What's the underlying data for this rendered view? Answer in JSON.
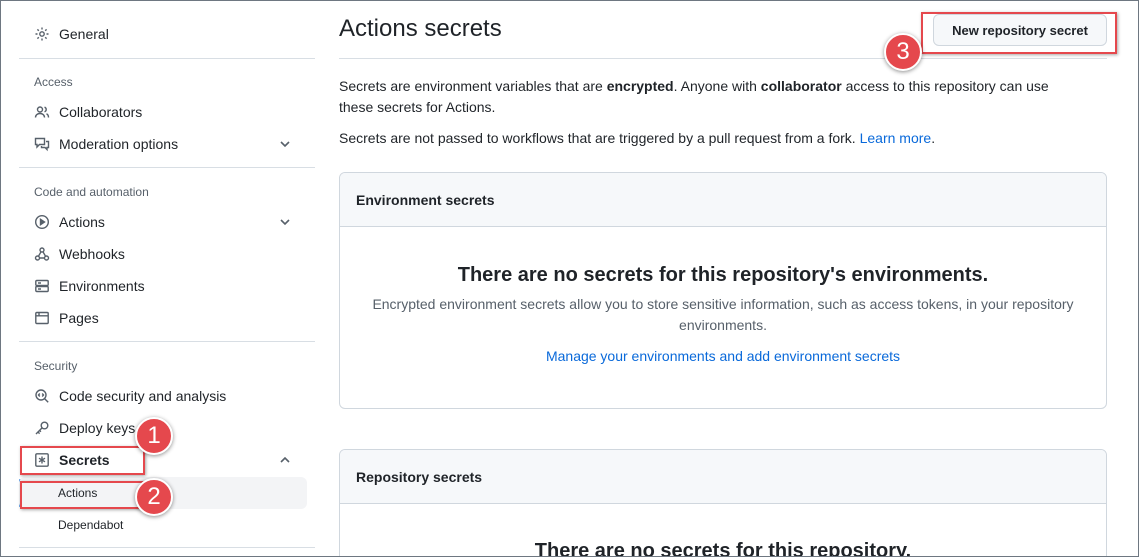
{
  "sidebar": {
    "general": "General",
    "access_label": "Access",
    "collaborators": "Collaborators",
    "moderation": "Moderation options",
    "code_automation_label": "Code and automation",
    "actions": "Actions",
    "webhooks": "Webhooks",
    "environments": "Environments",
    "pages": "Pages",
    "security_label": "Security",
    "code_security": "Code security and analysis",
    "deploy_keys": "Deploy keys",
    "secrets": "Secrets",
    "secrets_sub": {
      "actions": "Actions",
      "dependabot": "Dependabot"
    }
  },
  "main": {
    "title": "Actions secrets",
    "new_secret_button": "New repository secret",
    "intro": {
      "p1_a": "Secrets are environment variables that are ",
      "p1_b": "encrypted",
      "p1_c": ". Anyone with ",
      "p1_d": "collaborator",
      "p1_e": " access to this repository can use these secrets for Actions.",
      "p2_a": "Secrets are not passed to workflows that are triggered by a pull request from a fork. ",
      "p2_link": "Learn more",
      "p2_end": "."
    },
    "environment_secrets": {
      "header": "Environment secrets",
      "blank_title": "There are no secrets for this repository's environments.",
      "blank_desc": "Encrypted environment secrets allow you to store sensitive information, such as access tokens, in your repository environments.",
      "blank_link": "Manage your environments and add environment secrets"
    },
    "repository_secrets": {
      "header": "Repository secrets",
      "blank_title": "There are no secrets for this repository."
    }
  },
  "annotations": {
    "badge_1": "1",
    "badge_2": "2",
    "badge_3": "3",
    "color": "#e5484d"
  },
  "theme": {
    "link_color": "#0969da",
    "border_color": "#d0d7de",
    "active_bar_color": "#0969da"
  }
}
